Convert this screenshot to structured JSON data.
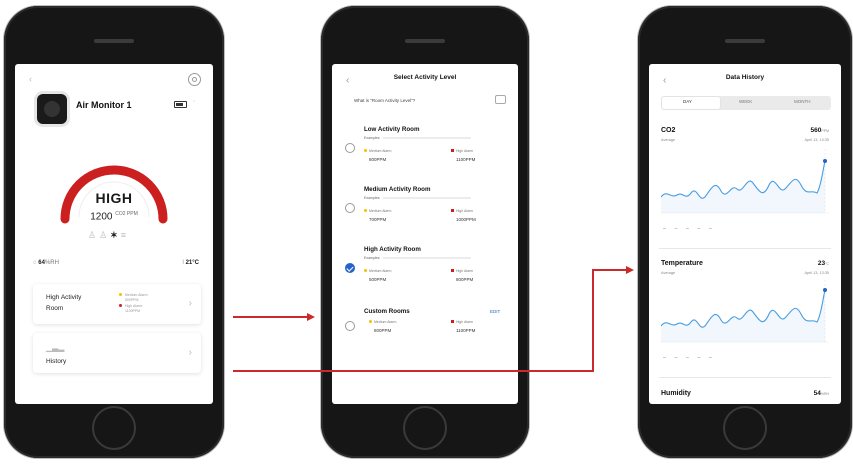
{
  "colors": {
    "accent_red": "#cc1f1f",
    "selected_blue": "#2563c9",
    "chart_blue": "#4a9ee0"
  },
  "screen1": {
    "device_name": "Air Monitor 1",
    "level": "HIGH",
    "co2_value": "1200",
    "co2_unit": "CO2 PPM",
    "humidity": "64",
    "humidity_unit": "%RH",
    "temperature": "21°C",
    "activity_card": {
      "title_line1": "High Activity",
      "title_line2": "Room",
      "medium_label": "Medium Alarm:",
      "medium_value": "800PPM",
      "high_label": "High Alarm:",
      "high_value": "1100PPM"
    },
    "history_label": "History"
  },
  "screen2": {
    "title": "Select Activity Level",
    "question": "What is \"Room Activity Level\"?",
    "example_label": "Examples:",
    "medium_label": "Medium Alarm",
    "high_label": "High Alarm",
    "options": [
      {
        "title": "Low Activity Room",
        "medium": "800PPM",
        "high": "1100PPM",
        "selected": false
      },
      {
        "title": "Medium Activity Room",
        "medium": "700PPM",
        "high": "1000PPM",
        "selected": false
      },
      {
        "title": "High Activity Room",
        "medium": "500PPM",
        "high": "800PPM",
        "selected": true
      },
      {
        "title": "Custom Rooms",
        "medium": "800PPM",
        "high": "1100PPM",
        "selected": false,
        "edit_label": "EDIT"
      }
    ]
  },
  "screen3": {
    "title": "Data History",
    "tabs": [
      "DAY",
      "WEEK",
      "MONTH"
    ],
    "sections": [
      {
        "title": "CO2",
        "sub": "Average",
        "value": "560",
        "unit": "PPM",
        "date": "April 13, 13:35"
      },
      {
        "title": "Temperature",
        "sub": "Average",
        "value": "23",
        "unit": "°C",
        "date": "April 13, 13:35"
      },
      {
        "title": "Humidity",
        "sub": "",
        "value": "54",
        "unit": "%RH",
        "date": ""
      }
    ]
  }
}
